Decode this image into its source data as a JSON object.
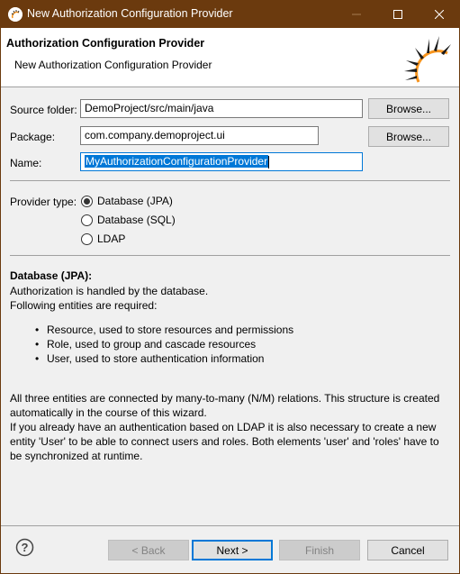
{
  "window": {
    "title": "New Authorization Configuration Provider",
    "controls": {
      "minimize": "minimize",
      "maximize": "maximize",
      "close": "close"
    }
  },
  "banner": {
    "title": "Authorization Configuration Provider",
    "subtitle": "New Authorization Configuration Provider",
    "logo_colors": {
      "arc": "#f7941d",
      "rays": "#1a1a1a"
    }
  },
  "form": {
    "source_folder": {
      "label": "Source folder:",
      "value": "DemoProject/src/main/java",
      "browse_label": "Browse..."
    },
    "package": {
      "label": "Package:",
      "value": "com.company.demoproject.ui",
      "browse_label": "Browse..."
    },
    "name": {
      "label": "Name:",
      "value": "MyAuthorizationConfigurationProvider",
      "selected": true
    }
  },
  "provider_type": {
    "label": "Provider type:",
    "options": [
      {
        "label": "Database (JPA)",
        "checked": true
      },
      {
        "label": "Database (SQL)",
        "checked": false
      },
      {
        "label": "LDAP",
        "checked": false
      }
    ]
  },
  "description": {
    "title": "Database (JPA):",
    "lines": [
      "Authorization is handled by the database.",
      "Following entities are required:"
    ],
    "bullets": [
      "Resource, used to store resources and permissions",
      "Role, used to group and cascade resources",
      "User, used to store authentication information"
    ],
    "paragraph_lines": [
      "All three entities are connected by many-to-many (N/M) relations. This structure is created",
      "automatically in the course of this wizard.",
      "If you already have an authentication based on LDAP it is also necessary to create a new",
      "entity 'User' to be able to connect users and roles. Both elements 'user' and 'roles' have to",
      "be synchronized at runtime."
    ]
  },
  "footer": {
    "help_icon": "help-icon",
    "back_label": "< Back",
    "next_label": "Next >",
    "finish_label": "Finish",
    "cancel_label": "Cancel",
    "back_enabled": false,
    "finish_enabled": false
  },
  "colors": {
    "titlebar": "#6b3a0e",
    "accent": "#0078d7",
    "dialog_bg": "#f0f0f0"
  }
}
